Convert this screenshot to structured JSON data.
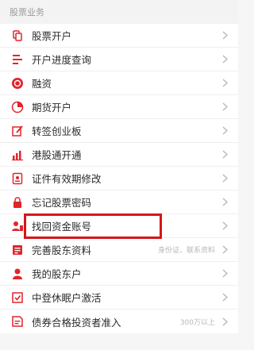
{
  "section": {
    "title": "股票业务"
  },
  "items": [
    {
      "label": "股票开户",
      "icon": "stock-account-icon",
      "hint": ""
    },
    {
      "label": "开户进度查询",
      "icon": "progress-query-icon",
      "hint": ""
    },
    {
      "label": "融资",
      "icon": "financing-icon",
      "hint": ""
    },
    {
      "label": "期货开户",
      "icon": "futures-account-icon",
      "hint": ""
    },
    {
      "label": "转签创业板",
      "icon": "sign-edit-icon",
      "hint": ""
    },
    {
      "label": "港股通开通",
      "icon": "hk-connect-icon",
      "hint": ""
    },
    {
      "label": "证件有效期修改",
      "icon": "id-card-icon",
      "hint": ""
    },
    {
      "label": "忘记股票密码",
      "icon": "lock-icon",
      "hint": ""
    },
    {
      "label": "找回资金账号",
      "icon": "user-fund-icon",
      "hint": "",
      "highlighted": true
    },
    {
      "label": "完善股东资料",
      "icon": "shareholder-info-icon",
      "hint": "身份证、联系资料"
    },
    {
      "label": "我的股东户",
      "icon": "user-icon",
      "hint": ""
    },
    {
      "label": "中登休眠户激活",
      "icon": "account-activate-icon",
      "hint": ""
    },
    {
      "label": "债券合格投资者准入",
      "icon": "bond-investor-icon",
      "hint": "300万以上"
    }
  ],
  "colors": {
    "accent": "#e2242b",
    "highlight": "#d6161a"
  }
}
